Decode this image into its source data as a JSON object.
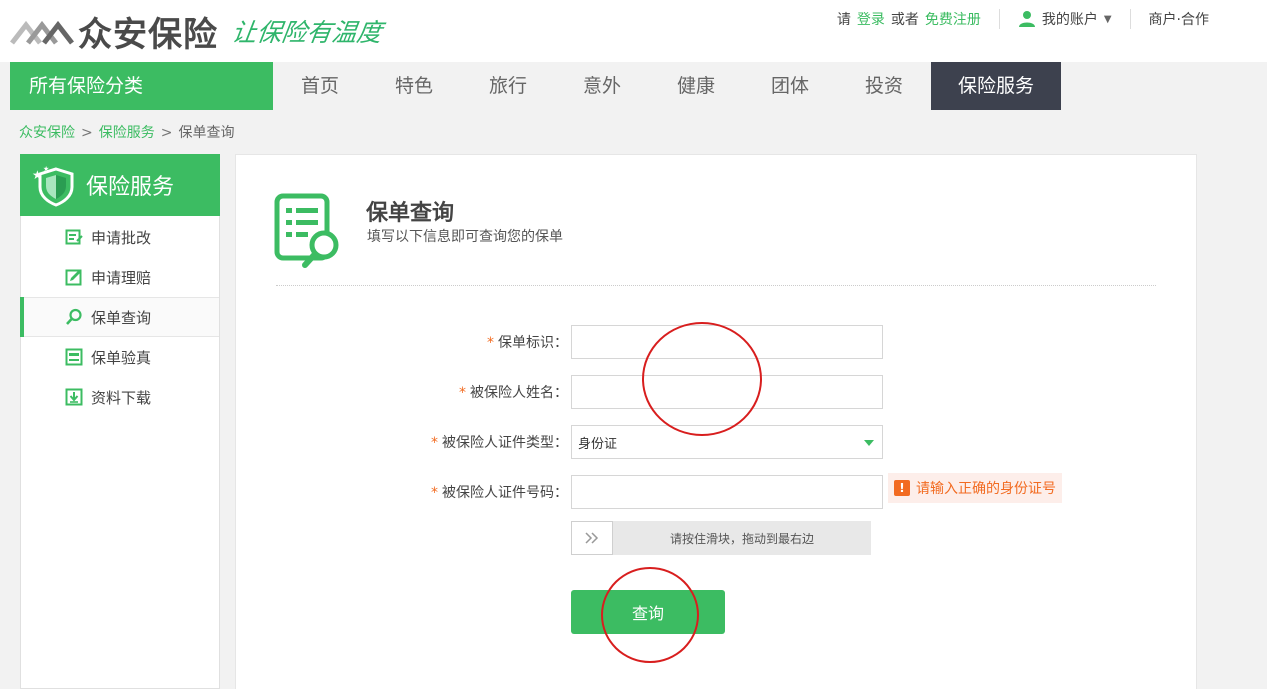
{
  "header": {
    "logo_text": "众安保险",
    "slogan": "让保险有温度",
    "login_prefix": "请",
    "login": "登录",
    "or": "或者",
    "register": "免费注册",
    "account": "我的账户",
    "merchant": "商户·合作"
  },
  "nav": {
    "all_categories": "所有保险分类",
    "items": [
      "首页",
      "特色",
      "旅行",
      "意外",
      "健康",
      "团体",
      "投资",
      "保险服务"
    ]
  },
  "breadcrumb": [
    "众安保险",
    "保险服务",
    "保单查询"
  ],
  "sidebar": {
    "title": "保险服务",
    "items": [
      {
        "label": "申请批改",
        "icon": "edit-list-icon"
      },
      {
        "label": "申请理赔",
        "icon": "pencil-box-icon"
      },
      {
        "label": "保单查询",
        "icon": "search-icon"
      },
      {
        "label": "保单验真",
        "icon": "document-check-icon"
      },
      {
        "label": "资料下载",
        "icon": "download-icon"
      }
    ]
  },
  "main": {
    "title": "保单查询",
    "subtitle": "填写以下信息即可查询您的保单",
    "fields": {
      "policy_id": {
        "label": "保单标识：",
        "value": ""
      },
      "insured_name": {
        "label": "被保险人姓名：",
        "value": ""
      },
      "id_type": {
        "label": "被保险人证件类型：",
        "value": "身份证"
      },
      "id_number": {
        "label": "被保险人证件号码：",
        "value": ""
      }
    },
    "error_message": "请输入正确的身份证号",
    "slider_hint": "请按住滑块，拖动到最右边",
    "submit": "查询"
  },
  "colors": {
    "brand_green": "#3cbc62",
    "nav_active": "#3d414e",
    "error_orange": "#f26b21",
    "annotation_red": "#d81e1e"
  }
}
